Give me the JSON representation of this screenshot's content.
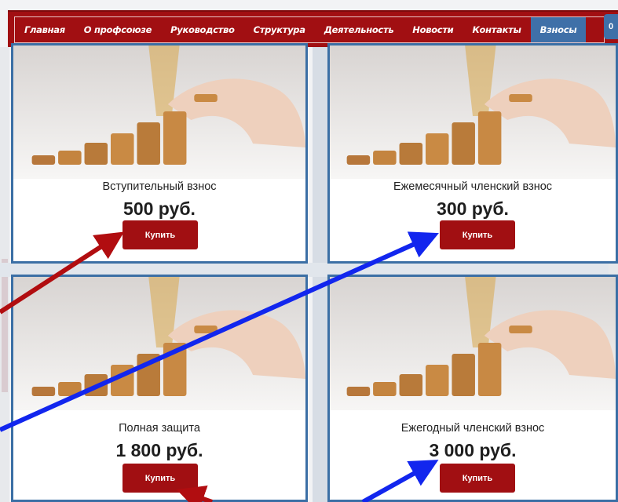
{
  "nav": {
    "items": [
      {
        "label": "Главная",
        "active": false
      },
      {
        "label": "О профсоюзе",
        "active": false
      },
      {
        "label": "Руководство",
        "active": false
      },
      {
        "label": "Структура",
        "active": false
      },
      {
        "label": "Деятельность",
        "active": false
      },
      {
        "label": "Новости",
        "active": false
      },
      {
        "label": "Контакты",
        "active": false
      },
      {
        "label": "Взносы",
        "active": true
      }
    ],
    "cart_count": "0"
  },
  "products": [
    {
      "title": "Вступительный взнос",
      "price": "500 руб.",
      "button": "Купить"
    },
    {
      "title": "Ежемесячный членский взнос",
      "price": "300 руб.",
      "button": "Купить"
    },
    {
      "title": "Полная защита",
      "price": "1 800 руб.",
      "button": "Купить"
    },
    {
      "title": "Ежегодный членский взнос",
      "price": "3 000 руб.",
      "button": "Купить"
    }
  ],
  "colors": {
    "nav_bg": "#a10f12",
    "nav_active": "#3f70a8",
    "card_border": "#3b6fa5",
    "button_bg": "#a10f12",
    "arrow_red": "#b10d10",
    "arrow_blue": "#1226ee"
  }
}
